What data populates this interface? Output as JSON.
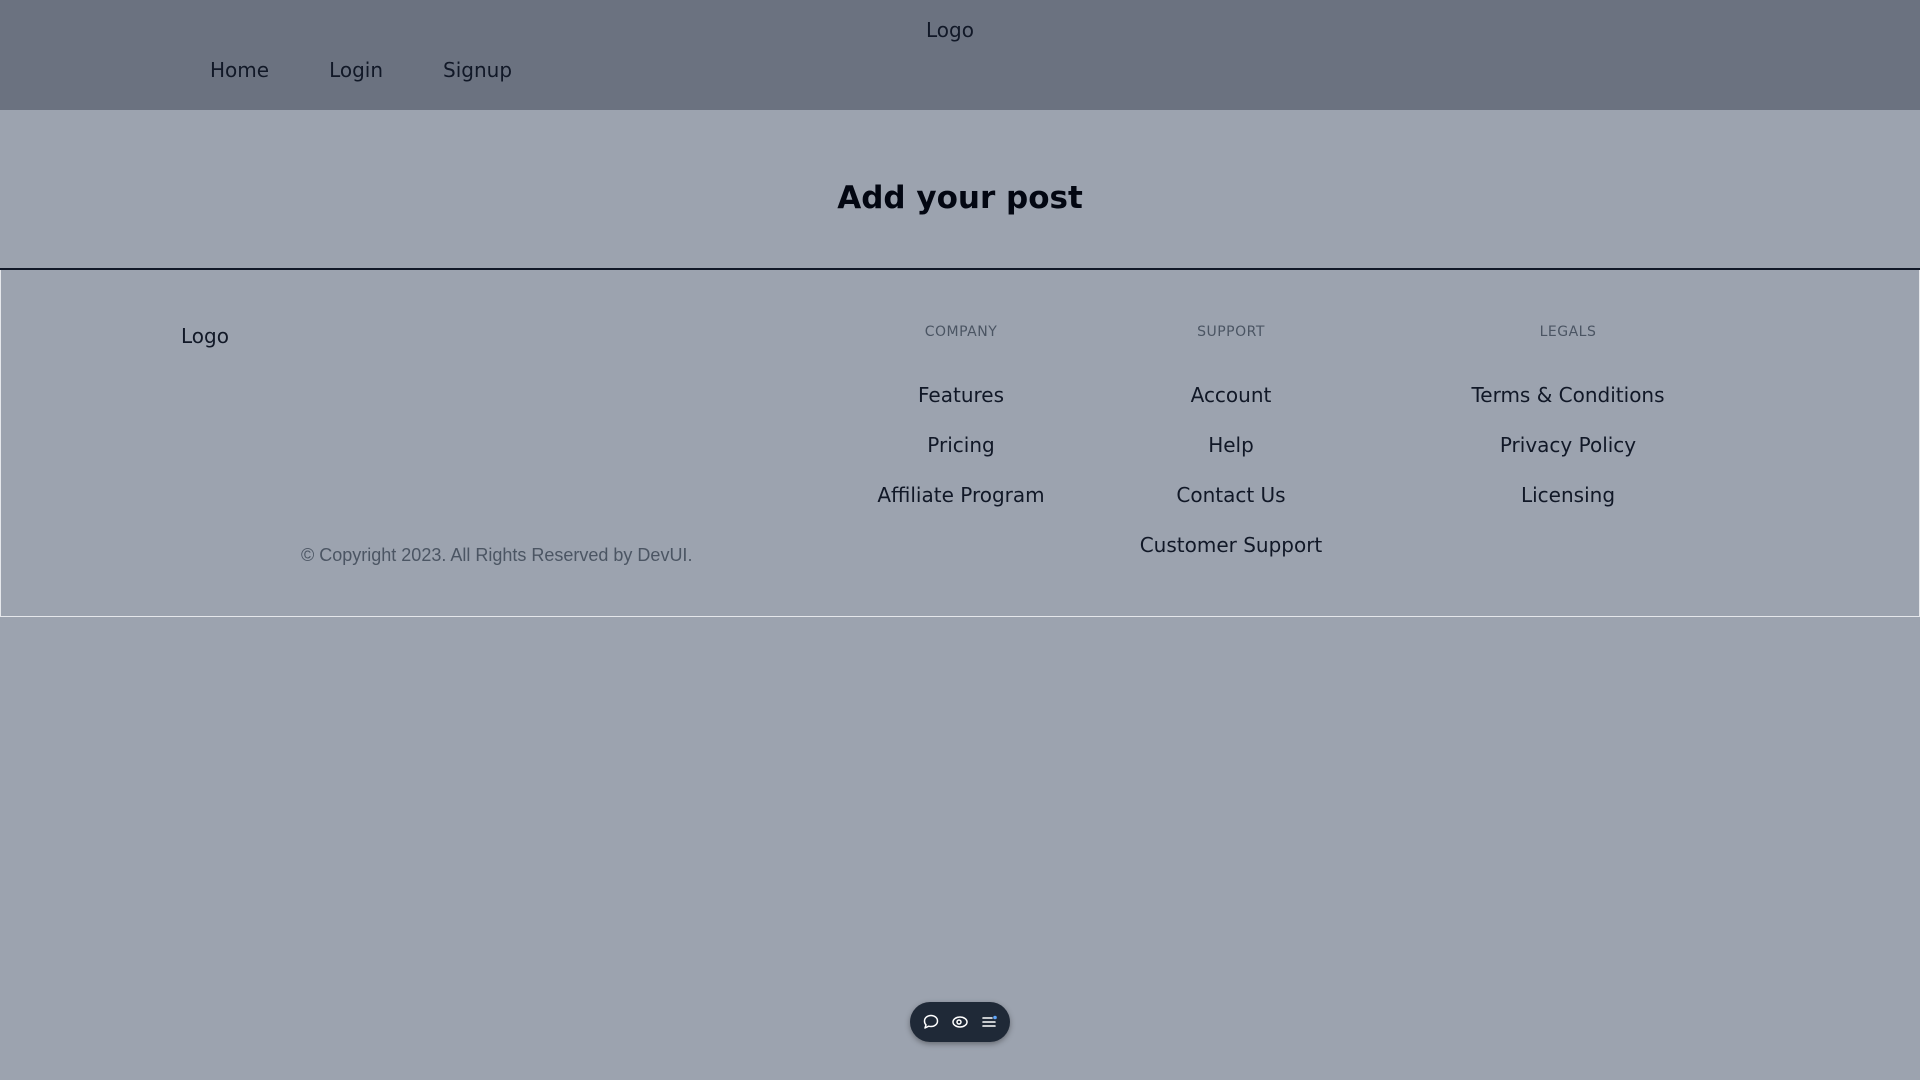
{
  "header": {
    "logo": "Logo",
    "nav": [
      {
        "label": "Home"
      },
      {
        "label": "Login"
      },
      {
        "label": "Signup"
      }
    ]
  },
  "main": {
    "title": "Add your post"
  },
  "footer": {
    "logo": "Logo",
    "copyright": "© Copyright 2023. All Rights Reserved by DevUI.",
    "columns": [
      {
        "title": "COMPANY",
        "links": [
          "Features",
          "Pricing",
          "Affiliate Program"
        ]
      },
      {
        "title": "SUPPORT",
        "links": [
          "Account",
          "Help",
          "Contact Us",
          "Customer Support"
        ]
      },
      {
        "title": "LEGALS",
        "links": [
          "Terms & Conditions",
          "Privacy Policy",
          "Licensing"
        ]
      }
    ]
  },
  "toolbar": {
    "icons": [
      "comment-icon",
      "eye-icon",
      "list-icon"
    ]
  },
  "colors": {
    "page_background": "#9ca3af",
    "header_background": "#6b7280",
    "toolbar_background": "#1f2937",
    "text": "#111827",
    "muted_text": "#4b5563"
  }
}
